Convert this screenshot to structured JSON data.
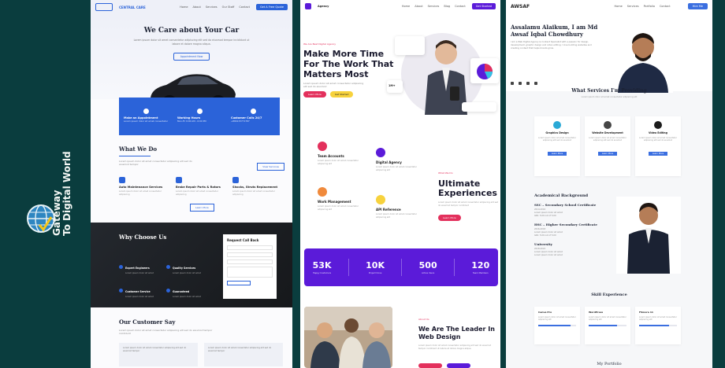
{
  "brand": {
    "line1": "Gateway",
    "line2": "To Digital World"
  },
  "car_site": {
    "logo": "CENTRAL CARE",
    "nav": [
      "Home",
      "About",
      "Services",
      "Our Staff",
      "Contact"
    ],
    "nav_button": "Get A Free Quote",
    "hero_title": "We Care about Your Car",
    "hero_text": "Lorem ipsum dolor sit amet consectetur adipiscing elit sed do eiusmod tempor incididunt ut labore et dolore magna aliqua.",
    "hero_button": "Appointment Now",
    "features": [
      {
        "title": "Make an Appointment",
        "text": "Lorem ipsum dolor sit amet consectetur"
      },
      {
        "title": "Working Hours",
        "text": "Mon-Fri 9:00 AM - 6:00 PM"
      },
      {
        "title": "Customer Calls 24/7",
        "text": "+880133771787"
      }
    ],
    "what_title": "What We Do",
    "what_text": "Lorem ipsum dolor sit amet consectetur adipiscing elit sed do eiusmod tempor",
    "view_button": "View Services",
    "services": [
      {
        "title": "Auto Maintenance Services",
        "text": "Lorem ipsum dolor sit amet consectetur adipiscing"
      },
      {
        "title": "Brake Repair Parts & Rotors",
        "text": "Lorem ipsum dolor sit amet consectetur adipiscing"
      },
      {
        "title": "Shocks, Struts Replacement",
        "text": "Lorem ipsum dolor sit amet consectetur adipiscing"
      }
    ],
    "more_button": "Learn More",
    "why_title": "Why Choose Us",
    "why_items": [
      {
        "title": "Expert Engineers",
        "text": "Lorem ipsum dolor sit amet"
      },
      {
        "title": "Quality Services",
        "text": "Lorem ipsum dolor sit amet"
      },
      {
        "title": "Customer Service",
        "text": "Lorem ipsum dolor sit amet"
      },
      {
        "title": "Guaranteed",
        "text": "Lorem ipsum dolor sit amet"
      }
    ],
    "form_title": "Request Call Back",
    "customer_title": "Our Customer Say",
    "customer_text": "Lorem ipsum dolor sit amet consectetur adipiscing elit sed do eiusmod tempor incididunt",
    "quotes": [
      "Lorem ipsum dolor sit amet consectetur adipiscing elit sed do eiusmod tempor",
      "Lorem ipsum dolor sit amet consectetur adipiscing elit sed do eiusmod tempor"
    ]
  },
  "agency_site": {
    "logo": "Agency",
    "nav": [
      "Home",
      "About",
      "Services",
      "Blog",
      "Contact"
    ],
    "nav_button": "Get Started",
    "tag": "We Are Best Digital Agency",
    "hero_title": "Make More Time For The Work That Matters Most",
    "hero_text": "Lorem ipsum dolor sit amet consectetur adipiscing elit sed do eiusmod",
    "btn_primary": "Learn More",
    "btn_secondary": "Get Started",
    "metric_label": "1M+",
    "services": [
      {
        "title": "Team Accounts",
        "text": "Lorem ipsum dolor sit amet consectetur adipiscing elit"
      },
      {
        "title": "Digital Agency",
        "text": "Lorem ipsum dolor sit amet consectetur adipiscing elit"
      },
      {
        "title": "Work Management",
        "text": "Lorem ipsum dolor sit amet consectetur adipiscing elit"
      },
      {
        "title": "API Reference",
        "text": "Lorem ipsum dolor sit amet consectetur adipiscing elit"
      }
    ],
    "ue_tag": "What We Do",
    "ue_title": "Ultimate Experiences",
    "ue_text": "Lorem ipsum dolor sit amet consectetur adipiscing elit sed do eiusmod tempor incididunt",
    "ue_button": "Learn More",
    "stats": [
      {
        "value": "53K",
        "label": "Happy Customers"
      },
      {
        "value": "10K",
        "label": "Project Done"
      },
      {
        "value": "500",
        "label": "Active Users"
      },
      {
        "value": "120",
        "label": "Team Members"
      }
    ],
    "leader_tag": "About Us",
    "leader_title": "We Are The Leader In Web Design",
    "leader_text": "Lorem ipsum dolor sit amet consectetur adipiscing elit sed do eiusmod tempor incididunt ut labore et dolore magna aliqua."
  },
  "portfolio_site": {
    "logo": "AWSAF",
    "nav": [
      "Home",
      "Services",
      "Portfolio",
      "Contact"
    ],
    "nav_button": "Hire Me",
    "hero_title": "Assalamu Alaikum, I am Md Awsaf Iqbal Chowdhury",
    "hero_text": "I am a Web Digital Agency & Content Specialist with a passion for design, development, graphic design and video editing. I love building websites and creating content that helps brands grow.",
    "services_title": "What Services I'm Providing",
    "services_sub": "Lorem ipsum dolor sit amet consectetur adipiscing elit",
    "cards": [
      {
        "title": "Graphics Design",
        "text": "Lorem ipsum dolor sit amet consectetur adipiscing elit sed do eiusmod",
        "button": "Learn More"
      },
      {
        "title": "Website Development",
        "text": "Lorem ipsum dolor sit amet consectetur adipiscing elit sed do eiusmod",
        "button": "Learn More"
      },
      {
        "title": "Video Editing",
        "text": "Lorem ipsum dolor sit amet consectetur adipiscing elit sed do eiusmod",
        "button": "Learn More"
      }
    ],
    "academic_title": "Academical Background",
    "ssc_title": "SSC – Secondary School Certificate",
    "ssc_items": [
      "2014-2016",
      "Lorem ipsum dolor sit amet",
      "GPA: 5.00 out of 5.00"
    ],
    "hsc_title": "HSC – Higher Secondary Certificate",
    "hsc_items": [
      "2016-2018",
      "Lorem ipsum dolor sit amet",
      "GPA: 5.00 out of 5.00"
    ],
    "uni_title": "University",
    "uni_items": [
      "2018-2022",
      "Lorem ipsum dolor sit amet",
      "Lorem ipsum dolor sit amet"
    ],
    "skill_title": "Skill Experience",
    "skills": [
      {
        "title": "Canva Pro",
        "text": "Lorem ipsum dolor sit amet consectetur adipiscing elit",
        "level": 0.85
      },
      {
        "title": "WordPress",
        "text": "Lorem ipsum dolor sit amet consectetur adipiscing elit",
        "level": 0.75
      },
      {
        "title": "Filmora 11",
        "text": "Lorem ipsum dolor sit amet consectetur adipiscing elit",
        "level": 0.8
      }
    ],
    "portfolio_title": "My Portfolio"
  }
}
